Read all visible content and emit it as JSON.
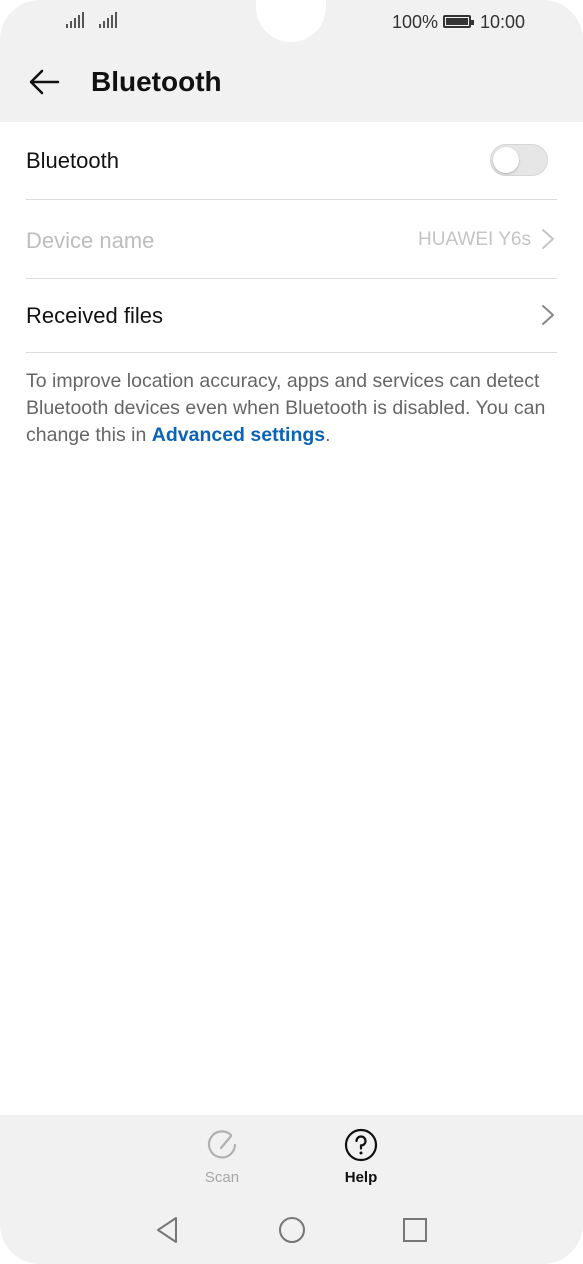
{
  "status_bar": {
    "battery": "100%",
    "time": "10:00"
  },
  "header": {
    "title": "Bluetooth"
  },
  "settings": {
    "bluetooth": {
      "label": "Bluetooth",
      "enabled": false
    },
    "device_name": {
      "label": "Device name",
      "value": "HUAWEI Y6s"
    },
    "received_files": {
      "label": "Received files"
    }
  },
  "info": {
    "text": "To improve location accuracy, apps and services can detect Bluetooth devices even when Bluetooth is disabled. You can change this in ",
    "link": "Advanced settings",
    "suffix": "."
  },
  "bottom_bar": {
    "scan_label": "Scan",
    "help_label": "Help"
  },
  "colors": {
    "link": "#0b63b5",
    "bar_bg": "#f1f1f1",
    "disabled_text": "#bdbdbd"
  },
  "icons": [
    "back-arrow-icon",
    "chevron-right-icon",
    "scan-icon",
    "help-icon",
    "nav-back-icon",
    "nav-home-icon",
    "nav-recents-icon"
  ]
}
